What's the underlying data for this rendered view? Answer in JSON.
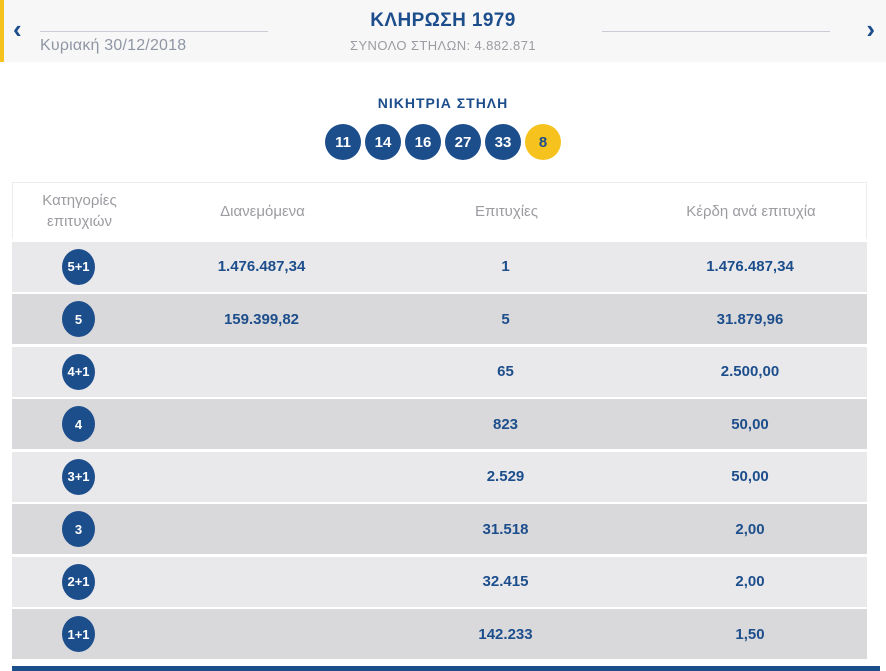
{
  "header": {
    "title": "ΚΛΗΡΩΣΗ 1979",
    "total_columns_label": "ΣΥΝΟΛΟ ΣΤΗΛΩΝ: 4.882.871",
    "date": "Κυριακή 30/12/2018",
    "prev_icon": "‹",
    "next_icon": "›"
  },
  "winning_column": {
    "title": "ΝΙΚΗΤΡΙΑ ΣΤΗΛΗ",
    "numbers": [
      "11",
      "14",
      "16",
      "27",
      "33"
    ],
    "joker": "8"
  },
  "results_table": {
    "headers": [
      "Κατηγορίες επιτυχιών",
      "Διανεμόμενα",
      "Επιτυχίες",
      "Κέρδη ανά επιτυχία"
    ],
    "rows": [
      {
        "category": "5+1",
        "distributed": "1.476.487,34",
        "winners": "1",
        "prize_per_winner": "1.476.487,34"
      },
      {
        "category": "5",
        "distributed": "159.399,82",
        "winners": "5",
        "prize_per_winner": "31.879,96"
      },
      {
        "category": "4+1",
        "distributed": "",
        "winners": "65",
        "prize_per_winner": "2.500,00"
      },
      {
        "category": "4",
        "distributed": "",
        "winners": "823",
        "prize_per_winner": "50,00"
      },
      {
        "category": "3+1",
        "distributed": "",
        "winners": "2.529",
        "prize_per_winner": "50,00"
      },
      {
        "category": "3",
        "distributed": "",
        "winners": "31.518",
        "prize_per_winner": "2,00"
      },
      {
        "category": "2+1",
        "distributed": "",
        "winners": "32.415",
        "prize_per_winner": "2,00"
      },
      {
        "category": "1+1",
        "distributed": "",
        "winners": "142.233",
        "prize_per_winner": "1,50"
      }
    ]
  },
  "colors": {
    "navy": "#1d4e8c",
    "yellow": "#f6c21d",
    "row_light": "#e9e9eb",
    "row_dark": "#d9d9db",
    "header_bg": "#f7f7f8",
    "muted_text": "#9b9ba1"
  }
}
